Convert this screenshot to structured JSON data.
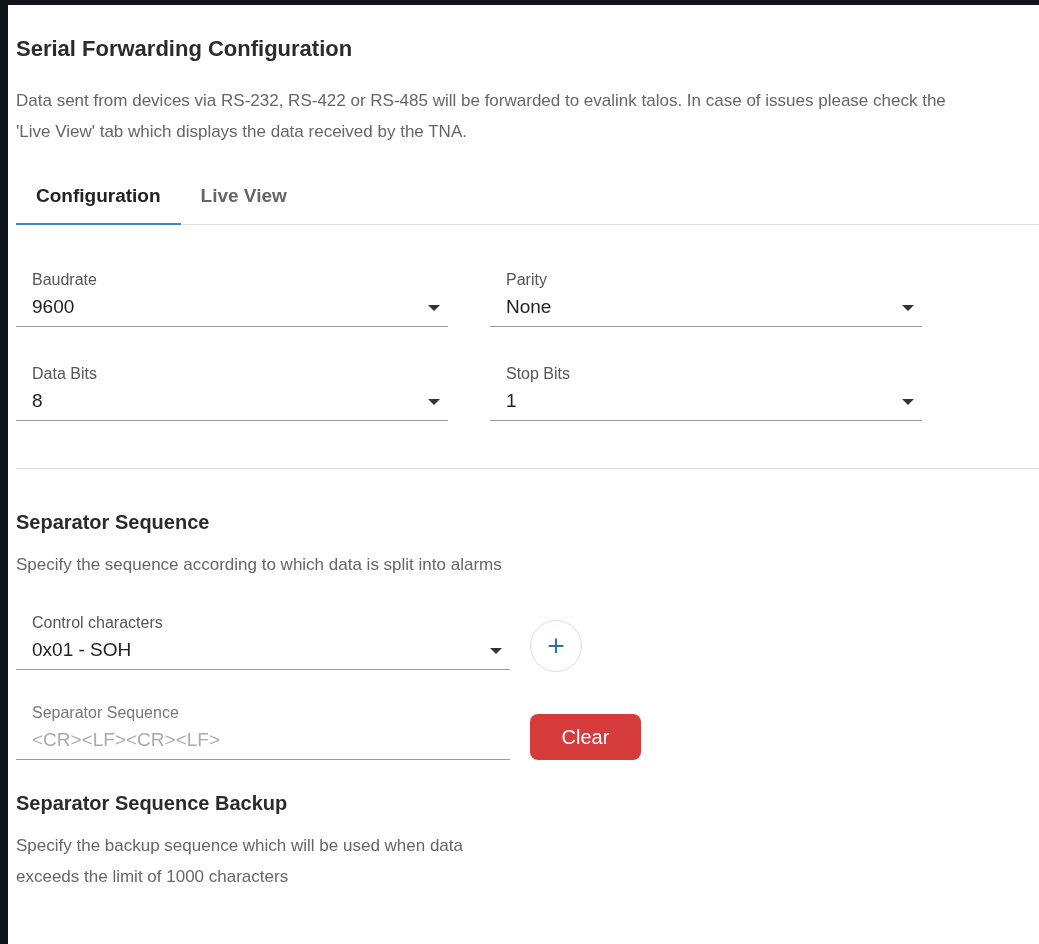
{
  "title": "Serial Forwarding Configuration",
  "description": "Data sent from devices via RS-232, RS-422 or RS-485 will be forwarded to evalink talos. In case of issues please check the 'Live View' tab which displays the data received by the TNA.",
  "tabs": [
    {
      "label": "Configuration",
      "selected": true
    },
    {
      "label": "Live View",
      "selected": false
    }
  ],
  "serial_fields": [
    {
      "label": "Baudrate",
      "value": "9600"
    },
    {
      "label": "Parity",
      "value": "None"
    },
    {
      "label": "Data Bits",
      "value": "8"
    },
    {
      "label": "Stop Bits",
      "value": "1"
    }
  ],
  "separator": {
    "heading": "Separator Sequence",
    "description": "Specify the sequence according to which data is split into alarms",
    "control_characters": {
      "label": "Control characters",
      "value": "0x01 - SOH"
    },
    "add_button": "+",
    "sequence_field": {
      "label": "Separator Sequence",
      "placeholder": "<CR><LF><CR><LF>"
    },
    "clear_button": "Clear"
  },
  "backup": {
    "heading": "Separator Sequence Backup",
    "description": "Specify the backup sequence which will be used when data exceeds the limit of 1000 characters"
  }
}
